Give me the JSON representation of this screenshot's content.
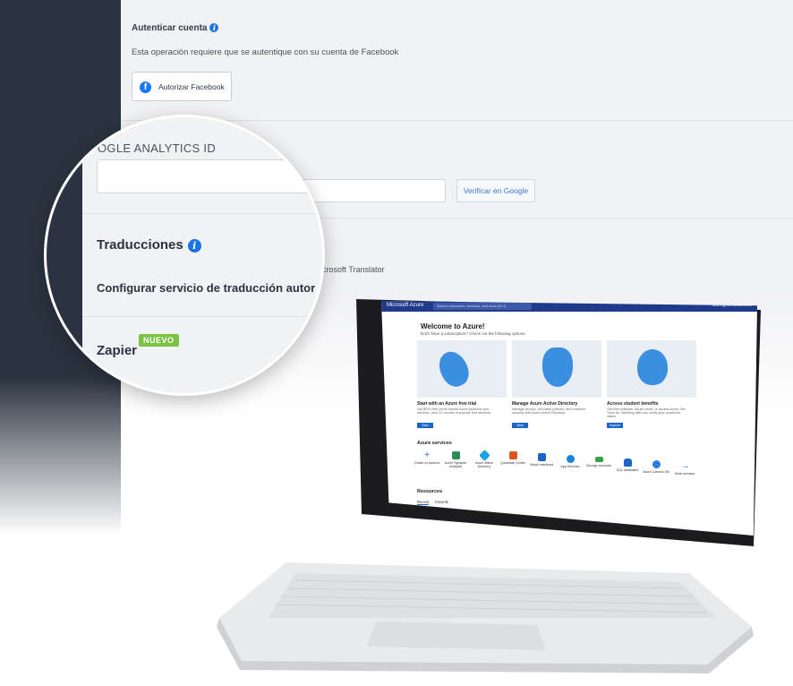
{
  "settings": {
    "auth": {
      "title": "Autenticar cuenta",
      "description": "Esta operación requiere que se autentique con su cuenta de Facebook",
      "button_label": "Autorizar Facebook"
    },
    "google": {
      "verify_label": "Verificar en Google"
    },
    "translation": {
      "partial_text": "a Microsoft Translator"
    }
  },
  "magnifier": {
    "ga_label": "OGLE ANALYTICS ID",
    "translations_title": "Traducciones",
    "translation_config": "Configurar servicio de traducción autor",
    "zapier_title": "Zapier",
    "new_badge": "NUEVO"
  },
  "azure": {
    "brand": "Microsoft Azure",
    "search_placeholder": "Search resources, services, and docs (G+/)",
    "user": "User@contoso.com",
    "welcome": "Welcome to Azure!",
    "welcome_sub": "Don't have a subscription? Check out the following options.",
    "cards": [
      {
        "title": "Start with an Azure free trial",
        "desc": "Get $200 free credit toward Azure products and services, plus 12 months of popular free services.",
        "button": "Start"
      },
      {
        "title": "Manage Azure Active Directory",
        "desc": "Manage access, set smart policies, and enhance security with Azure Active Directory.",
        "button": "View",
        "link": "Learn more"
      },
      {
        "title": "Access student benefits",
        "desc": "Get free software, Azure credit, or access Azure Dev Tools for Teaching after you verify your academic status.",
        "button": "Explore",
        "link": "Learn more"
      }
    ],
    "services_title": "Azure services",
    "services": [
      "Create a resource",
      "Azure Synapse Analytics",
      "Azure Active Directory",
      "Quickstart Center",
      "Virtual machines",
      "App Services",
      "Storage accounts",
      "SQL databases",
      "Azure Cosmos DB",
      "More services"
    ],
    "resources_title": "Resources",
    "resource_tabs": [
      "Recent",
      "Favorite"
    ],
    "colors": {
      "topbar": "#1f3a8a",
      "accent": "#1a66c9"
    }
  },
  "colors": {
    "sidebar": "#2b3340",
    "panel": "#f1f2f4",
    "info": "#1a73e8",
    "facebook": "#1877f2",
    "badge": "#7cc242"
  }
}
